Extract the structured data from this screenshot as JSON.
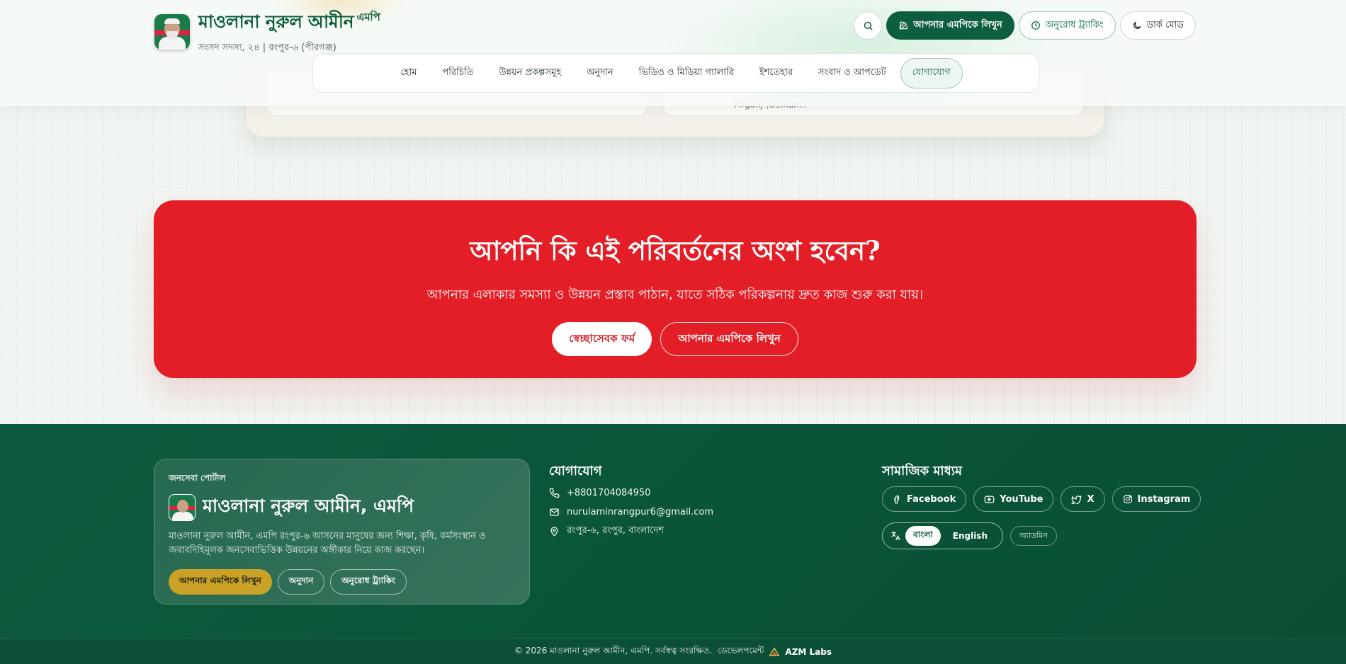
{
  "header": {
    "brand_title": "মাওলানা নুরুল আমীন",
    "brand_suffix": "এমপি",
    "brand_subtitle": "সংসদ সদস্য, ২৪ | রংপুর-৬ (পীরগঞ্জ)",
    "actions": {
      "write_mp": "আপনার এমপিকে লিখুন",
      "request_tracking": "অনুরোধ ট্র্যাকিং",
      "dark_mode": "ডার্ক মোড"
    },
    "nav": [
      {
        "label": "হোম"
      },
      {
        "label": "পরিচিতি"
      },
      {
        "label": "উন্নয়ন প্রকল্পসমূহ"
      },
      {
        "label": "অনুদান"
      },
      {
        "label": "ভিডিও ও মিডিয়া গ্যালারি"
      },
      {
        "label": "ইশতেহার"
      },
      {
        "label": "সংবাদ ও আপডেট"
      },
      {
        "label": "যোগাযোগ"
      }
    ]
  },
  "prev_section": {
    "peek_text": "Pirganj (Osman..."
  },
  "cta": {
    "title": "আপনি কি এই পরিবর্তনের অংশ হবেন?",
    "subtitle": "আপনার এলাকার সমস্যা ও উন্নয়ন প্রস্তাব পাঠান, যাতে সঠিক পরিকল্পনায় দ্রুত কাজ শুরু করা যায়।",
    "primary_button": "স্বেচ্ছাসেবক ফর্ম",
    "secondary_button": "আপনার এমপিকে লিখুন"
  },
  "footer": {
    "portal": {
      "kicker": "জনসেবা পোর্টাল",
      "title": "মাওলানা নুরুল আমীন, এমপি",
      "description": "মাওলানা নুরুল আমীন, এমপি রংপুর-৬ আসনের মানুষের জন্য শিক্ষা, কৃষি, কর্মসংস্থান ও জবাবদিহিমূলক জনসেবাভিত্তিক উন্নয়নের অঙ্গীকার নিয়ে কাজ করছেন।",
      "buttons": {
        "write_mp": "আপনার এমপিকে লিখুন",
        "donation": "অনুদান",
        "tracking": "অনুরোধ ট্র্যাকিং"
      }
    },
    "contact": {
      "title": "যোগাযোগ",
      "phone": "+8801704084950",
      "email": "nurulaminrangpur6@gmail.com",
      "address": "রংপুর-৬, রংপুর, বাংলাদেশ"
    },
    "social": {
      "title": "সামাজিক মাধ্যম",
      "links": [
        {
          "label": "Facebook",
          "icon": "facebook-icon"
        },
        {
          "label": "YouTube",
          "icon": "youtube-icon"
        },
        {
          "label": "X",
          "icon": "twitter-icon"
        },
        {
          "label": "Instagram",
          "icon": "instagram-icon"
        }
      ]
    },
    "language": {
      "bangla": "বাংলা",
      "english": "English",
      "selected": "বাংলা"
    },
    "admin_label": "অ্যাডমিন",
    "copyright": "© 2026 মাওলানা নুরুল আমীন, এমপি. সর্বস্বত্ব সংরক্ষিত.",
    "developer_label": "ডেভেলপমেন্ট",
    "developer_name": "AZM Labs"
  },
  "colors": {
    "brand_green": "#0d5e3f",
    "cta_red": "#e31e26",
    "gold": "#c9a227"
  }
}
